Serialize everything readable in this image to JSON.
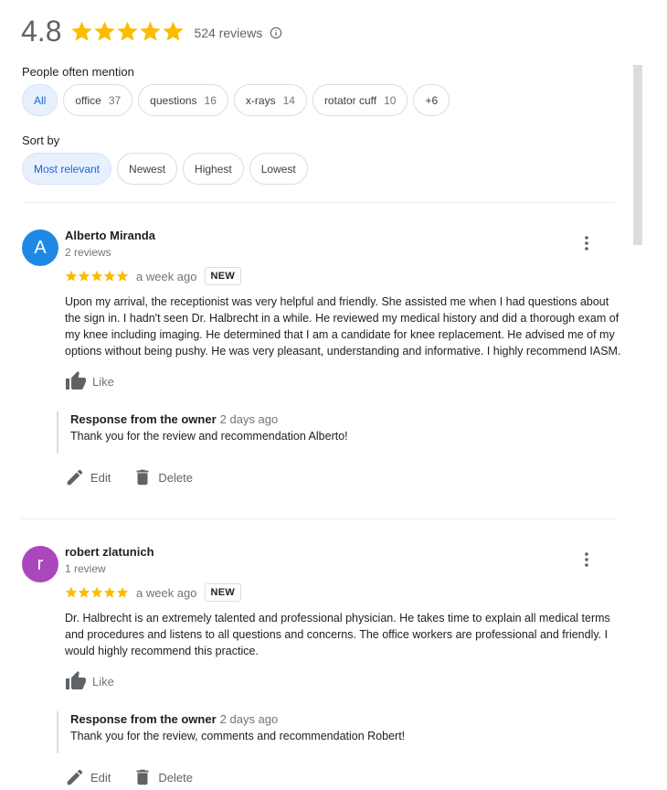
{
  "summary": {
    "rating": "4.8",
    "stars": 5,
    "review_count": "524 reviews",
    "star_color": "#fbbc04"
  },
  "mentions": {
    "label": "People often mention",
    "chips": [
      {
        "label": "All",
        "count": ""
      },
      {
        "label": "office",
        "count": "37"
      },
      {
        "label": "questions",
        "count": "16"
      },
      {
        "label": "x-rays",
        "count": "14"
      },
      {
        "label": "rotator cuff",
        "count": "10"
      },
      {
        "label": "+6",
        "count": ""
      }
    ]
  },
  "sort": {
    "label": "Sort by",
    "options": [
      "Most relevant",
      "Newest",
      "Highest",
      "Lowest"
    ]
  },
  "reviews": [
    {
      "avatar_letter": "A",
      "avatar_color": "#1e88e5",
      "name": "Alberto Miranda",
      "sub": "2 reviews",
      "stars": 5,
      "date": "a week ago",
      "badge": "NEW",
      "text": "Upon my arrival, the receptionist was very helpful and friendly. She assisted me when I had questions about the sign in. I hadn't seen Dr. Halbrecht in a while. He reviewed my medical history and did a thorough exam of my knee including imaging. He determined that I am a candidate for knee replacement. He advised me of my options without being pushy. He was very pleasant, understanding and informative. I highly recommend IASM.",
      "like_label": "Like",
      "owner_title": "Response from the owner",
      "owner_date": "2 days ago",
      "owner_text": "Thank you for the review and recommendation Alberto!",
      "edit_label": "Edit",
      "delete_label": "Delete"
    },
    {
      "avatar_letter": "r",
      "avatar_color": "#ab47bc",
      "name": "robert zlatunich",
      "sub": "1 review",
      "stars": 5,
      "date": "a week ago",
      "badge": "NEW",
      "text": "Dr. Halbrecht is an extremely talented and professional physician. He takes time to explain all medical terms and procedures and listens to all questions and concerns. The office workers are professional and friendly. I would highly recommend this practice.",
      "like_label": "Like",
      "owner_title": "Response from the owner",
      "owner_date": "2 days ago",
      "owner_text": "Thank you for the review, comments and recommendation Robert!",
      "edit_label": "Edit",
      "delete_label": "Delete"
    }
  ]
}
